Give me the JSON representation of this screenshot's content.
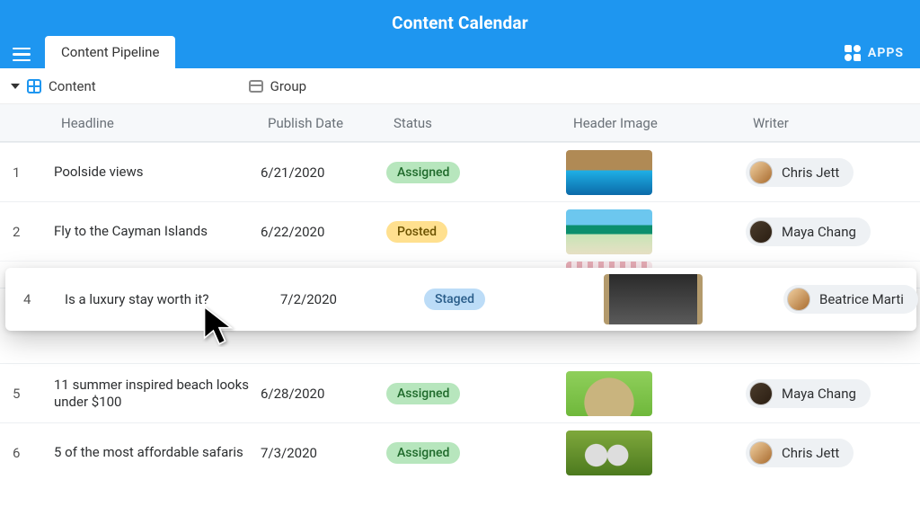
{
  "header": {
    "title": "Content Calendar",
    "tab": "Content Pipeline",
    "apps": "APPS"
  },
  "viewbar": {
    "contentLabel": "Content",
    "groupLabel": "Group"
  },
  "columns": {
    "headline": "Headline",
    "publishDate": "Publish Date",
    "status": "Status",
    "headerImage": "Header Image",
    "writer": "Writer"
  },
  "status": {
    "assigned": "Assigned",
    "posted": "Posted",
    "staged": "Staged"
  },
  "rows": [
    {
      "n": "1",
      "headline": "Poolside views",
      "date": "6/21/2020",
      "status": "Assigned",
      "pill": "green",
      "thumb": "thumb1",
      "writer": "Chris Jett",
      "av": "av-c"
    },
    {
      "n": "2",
      "headline": "Fly to the Cayman Islands",
      "date": "6/22/2020",
      "status": "Posted",
      "pill": "yellow",
      "thumb": "thumb2",
      "writer": "Maya Chang",
      "av": "av-b"
    },
    {
      "n": "5",
      "headline": "11 summer inspired beach looks under $100",
      "date": "6/28/2020",
      "status": "Assigned",
      "pill": "green",
      "thumb": "thumb5",
      "writer": "Maya Chang",
      "av": "av-b"
    },
    {
      "n": "6",
      "headline": "5 of the most affordable safaris",
      "date": "7/3/2020",
      "status": "Assigned",
      "pill": "green",
      "thumb": "thumb6",
      "writer": "Chris Jett",
      "av": "av-c"
    }
  ],
  "draggedRow": {
    "n": "4",
    "headline": "Is a luxury stay worth it?",
    "date": "7/2/2020",
    "status": "Staged",
    "pill": "blue",
    "thumb": "thumb4",
    "writer": "Beatrice Marti",
    "av": "av-c"
  },
  "occludedRow": {
    "writerInitial": ""
  }
}
